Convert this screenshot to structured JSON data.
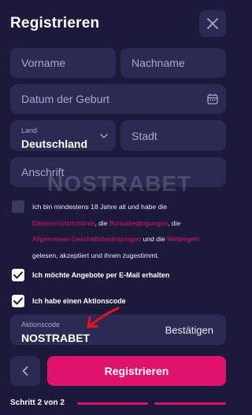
{
  "header": {
    "title": "Registrieren",
    "close_icon": "close-icon"
  },
  "form": {
    "first_name": {
      "placeholder": "Vorname"
    },
    "last_name": {
      "placeholder": "Nachname"
    },
    "birthdate": {
      "placeholder": "Datum der Geburt",
      "icon": "calendar-icon"
    },
    "country": {
      "label": "Land",
      "value": "Deutschland",
      "icon": "chevron-down-icon"
    },
    "city": {
      "placeholder": "Stadt"
    },
    "address": {
      "placeholder": "Anschrift"
    }
  },
  "watermark": "NOSTRABET",
  "terms": {
    "checked": false,
    "part1": "Ich bin mindestens 18 Jahre alt und habe die",
    "link_privacy": "Datenschutzrichtlinie",
    "sep1": ", die ",
    "link_bonus": "Bonusbedingungen",
    "sep2": ", die",
    "link_agb": "Allgemeinen Geschäftsbedingungen",
    "sep3": " und die ",
    "link_betting": "Wettregeln",
    "part2": "gelesen, akzeptiert und ihnen zugestimmt."
  },
  "offers": {
    "checked": true,
    "label": "Ich möchte Angebote per E-Mail erhalten"
  },
  "promo_checkbox": {
    "checked": true,
    "label": "Ich habe einen Aktionscode"
  },
  "promo": {
    "label": "Aktionscode",
    "value": "NOSTRABET",
    "confirm_label": "Bestätigen"
  },
  "footer": {
    "back_icon": "chevron-left-icon",
    "submit_label": "Registrieren",
    "step_label": "Schritt 2 von 2"
  },
  "colors": {
    "background": "#1b1a3b",
    "field": "#2b2a53",
    "accent": "#e0136c",
    "arrow": "#e0131f"
  }
}
